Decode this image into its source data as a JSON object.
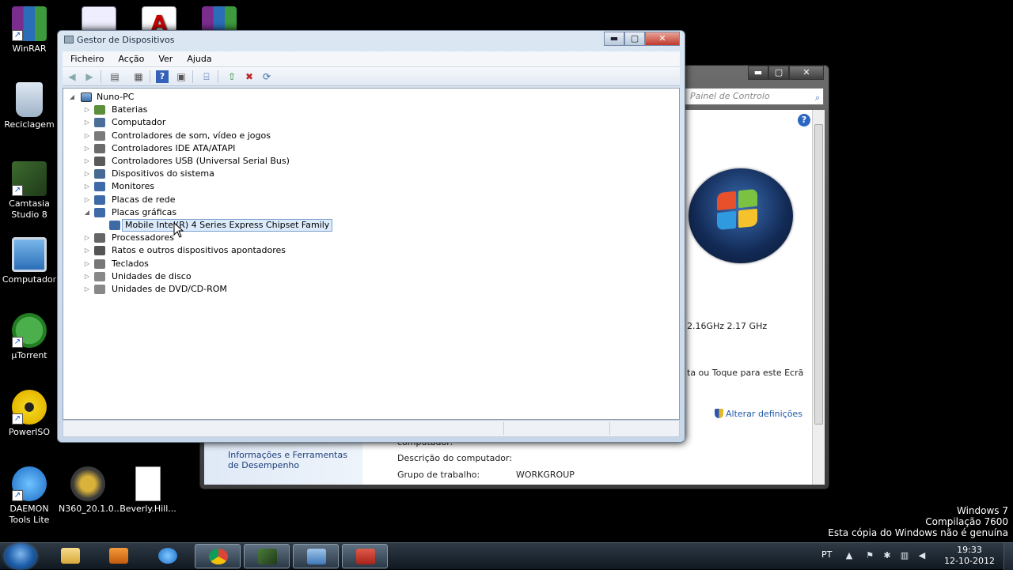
{
  "desktop": {
    "icons": {
      "winrar": "WinRAR",
      "reciclagem": "Reciclagem",
      "camtasia": "Camtasia Studio 8",
      "computador": "Computador",
      "utorrent": "µTorrent",
      "poweriso": "PowerISO",
      "daemon": "DAEMON Tools Lite",
      "n360": "N360_20.1.0...",
      "beverly": "Beverly.Hill..."
    },
    "watermark": {
      "line1": "Windows 7",
      "line2": "Compilação 7600",
      "line3": "Esta cópia do Windows não é genuína"
    }
  },
  "system_window": {
    "search_placeholder": "Painel de Controlo",
    "cpu_speed": "2.16GHz   2.17 GHz",
    "pen_touch": "ta ou Toque para este Ecrã",
    "change_settings": "Alterar definições",
    "sidebar_link": "Informações e Ferramentas de Desempenho",
    "partial_label": "computador:",
    "description_label": "Descrição do computador:",
    "workgroup_label": "Grupo de trabalho:",
    "workgroup_value": "WORKGROUP"
  },
  "device_manager": {
    "title": "Gestor de Dispositivos",
    "menu": [
      "Ficheiro",
      "Acção",
      "Ver",
      "Ajuda"
    ],
    "tree": {
      "root": "Nuno-PC",
      "categories": [
        "Baterias",
        "Computador",
        "Controladores de som, vídeo e jogos",
        "Controladores IDE ATA/ATAPI",
        "Controladores USB (Universal Serial Bus)",
        "Dispositivos do sistema",
        "Monitores",
        "Placas de rede",
        "Placas gráficas",
        "Processadores",
        "Ratos e outros dispositivos apontadores",
        "Teclados",
        "Unidades de disco",
        "Unidades de DVD/CD-ROM"
      ],
      "selected_child": "Mobile Intel(R) 4 Series Express Chipset Family"
    }
  },
  "taskbar": {
    "language": "PT",
    "time": "19:33",
    "date": "12-10-2012"
  }
}
